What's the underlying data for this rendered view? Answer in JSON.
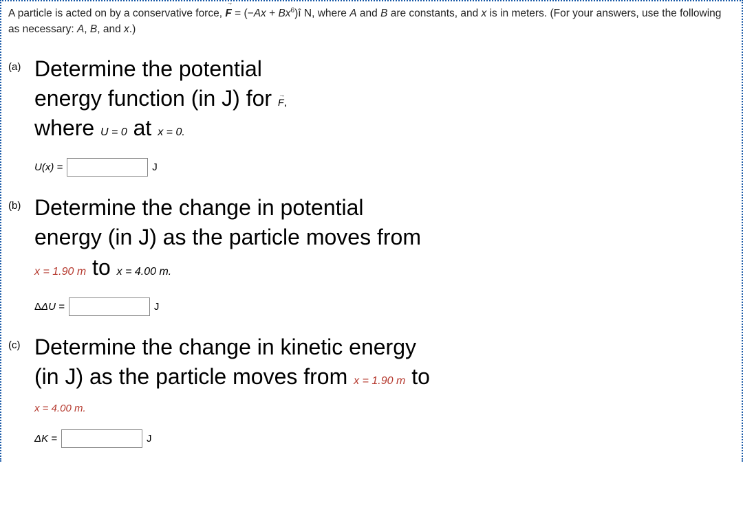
{
  "intro": {
    "prefix": "A particle is acted on by a conservative force, ",
    "force_lhs": "F",
    "force_eq": " = (−",
    "force_Ax": "Ax",
    "force_plus": " + ",
    "force_Bx": "Bx",
    "force_exp": "6",
    "force_close": ")",
    "force_unit": "î N, where ",
    "A": "A",
    "and1": " and ",
    "B": "B",
    "tail1": " are constants, and ",
    "x1": "x",
    "tail2": " is in meters. (For your answers, use the following as necessary: ",
    "A2": "A",
    "c1": ", ",
    "B2": "B",
    "c2": ", and ",
    "x2": "x",
    "tail3": ".)"
  },
  "parts": {
    "a": {
      "label": "(a)",
      "line1": "Determine the potential",
      "line2a": "energy function (in J) for ",
      "vecF": "F",
      "comma": ",",
      "line3a": "where ",
      "u0": "U = 0",
      "at": " at ",
      "x0": "x = 0.",
      "lhs": "U(x) =",
      "unit": "J"
    },
    "b": {
      "label": "(b)",
      "line1": "Determine the change in potential",
      "line2": "energy (in J) as the particle moves from",
      "x1": "x = 1.90 m",
      "to": " to ",
      "x2": "x = 4.00 m.",
      "lhs": "ΔU =",
      "unit": "J"
    },
    "c": {
      "label": "(c)",
      "line1": "Determine the change in kinetic energy",
      "line2a": "(in J) as the particle moves from ",
      "x1": "x = 1.90 m",
      "to": " to",
      "x2": "x = 4.00 m.",
      "lhs": "ΔK =",
      "unit": "J"
    }
  }
}
